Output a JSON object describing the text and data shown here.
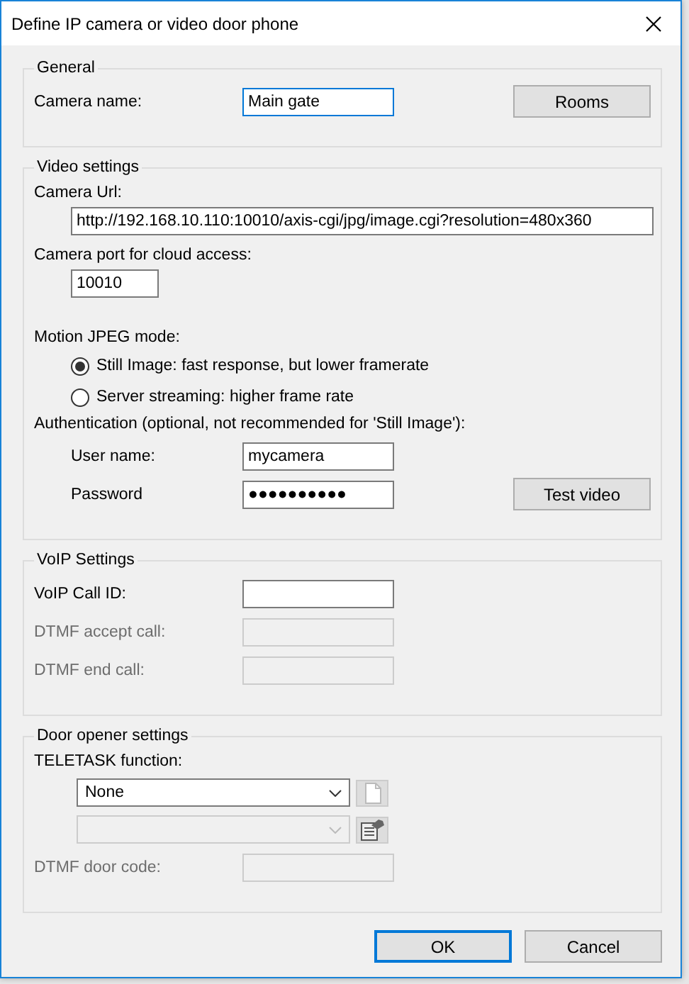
{
  "window": {
    "title": "Define IP camera or video door phone"
  },
  "groups": [
    {
      "legend": "General",
      "rows": [
        {
          "kind": "field",
          "label": "Camera name:",
          "value": "Main gate",
          "focused": true,
          "disabled": false,
          "indented": false,
          "button": "Rooms"
        }
      ]
    },
    {
      "legend": "Video settings",
      "rows": [
        {
          "kind": "label",
          "text": "Camera Url:"
        },
        {
          "kind": "wide_field",
          "value": "http://192.168.10.110:10010/axis-cgi/jpg/image.cgi?resolution=480x360"
        },
        {
          "kind": "label",
          "text": "Camera port for cloud access:"
        },
        {
          "kind": "short_field",
          "value": "10010"
        },
        {
          "kind": "label",
          "text": "Motion JPEG mode:"
        },
        {
          "kind": "radio",
          "label": "Still Image: fast response, but lower framerate",
          "selected": true
        },
        {
          "kind": "radio",
          "label": "Server streaming: higher frame rate",
          "selected": false
        },
        {
          "kind": "label",
          "text": "Authentication (optional, not recommended for 'Still Image'):"
        },
        {
          "kind": "field",
          "label": "User name:",
          "value": "mycamera",
          "focused": false,
          "disabled": false,
          "indented": true
        },
        {
          "kind": "field",
          "label": "Password",
          "value": "●●●●●●●●●●",
          "focused": false,
          "disabled": false,
          "indented": true,
          "button": "Test video"
        }
      ]
    },
    {
      "legend": "VoIP Settings",
      "rows": [
        {
          "kind": "field",
          "label": "VoIP Call ID:",
          "focused": false,
          "disabled": false,
          "indented": false
        },
        {
          "kind": "field",
          "label": "DTMF accept call:",
          "focused": false,
          "disabled": true,
          "indented": false
        },
        {
          "kind": "field",
          "label": "DTMF end call:",
          "focused": false,
          "disabled": true,
          "indented": false
        }
      ]
    },
    {
      "legend": "Door opener settings",
      "rows": [
        {
          "kind": "label",
          "text": "TELETASK function:"
        },
        {
          "kind": "combo",
          "value": "None",
          "disabled": false,
          "button_disabled": true
        },
        {
          "kind": "combo",
          "disabled": true,
          "button_disabled": false
        },
        {
          "kind": "field",
          "label": "DTMF door code:",
          "focused": false,
          "disabled": true,
          "indented": false
        }
      ]
    }
  ],
  "buttons": [
    {
      "label": "OK",
      "focused": true
    },
    {
      "label": "Cancel",
      "focused": false
    }
  ]
}
